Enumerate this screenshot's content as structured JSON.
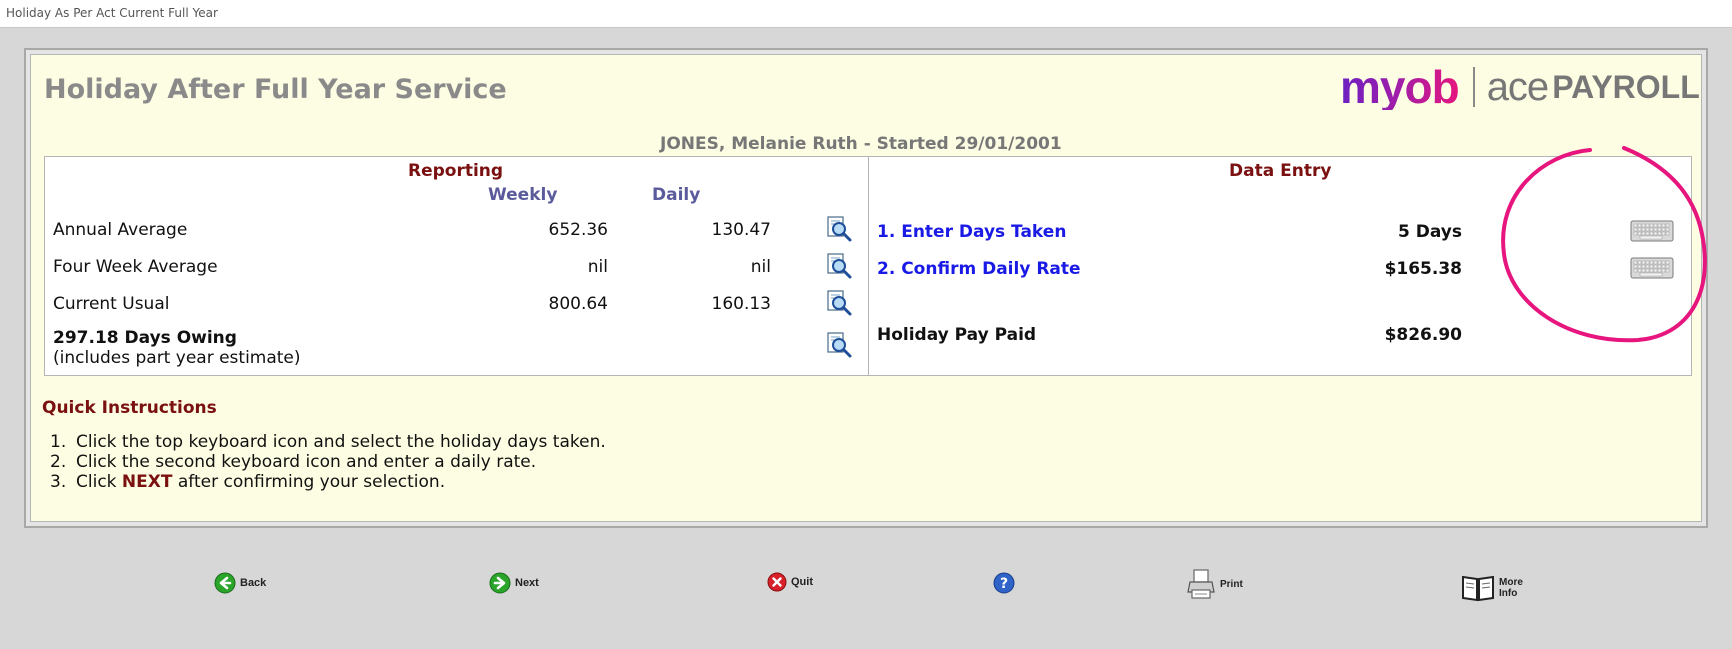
{
  "window": {
    "title": "Holiday As Per Act Current Full Year"
  },
  "header": {
    "title": "Holiday After Full Year Service",
    "logo": {
      "brand": "myob",
      "product_a": "ace",
      "product_b": "PAYROLL"
    },
    "employee": "JONES, Melanie Ruth - Started 29/01/2001"
  },
  "reporting": {
    "title": "Reporting",
    "col_weekly": "Weekly",
    "col_daily": "Daily",
    "rows": [
      {
        "label": "Annual Average",
        "weekly": "652.36",
        "daily": "130.47",
        "icon": "magnifier-icon"
      },
      {
        "label": "Four Week Average",
        "weekly": "nil",
        "daily": "nil",
        "icon": "magnifier-icon"
      },
      {
        "label": "Current Usual",
        "weekly": "800.64",
        "daily": "160.13",
        "icon": "magnifier-icon"
      }
    ],
    "owing": {
      "label": "297.18 Days Owing",
      "note": "(includes part year estimate)",
      "icon": "magnifier-icon"
    }
  },
  "data_entry": {
    "title": "Data Entry",
    "days_taken_label": "1. Enter Days Taken",
    "days_taken_value": "5 Days",
    "daily_rate_label": "2. Confirm Daily Rate",
    "daily_rate_value": "$165.38",
    "pay_paid_label": "Holiday Pay Paid",
    "pay_paid_value": "$826.90",
    "icon": "keyboard-icon"
  },
  "instructions": {
    "title": "Quick Instructions",
    "items": [
      {
        "num": "1.",
        "text": "Click the top keyboard icon and select the holiday days taken."
      },
      {
        "num": "2.",
        "text": "Click the second keyboard icon and enter a daily rate."
      },
      {
        "num": "3.",
        "pre": "Click ",
        "highlight": "NEXT",
        "post": " after confirming your selection."
      }
    ]
  },
  "toolbar": {
    "back": "Back",
    "next": "Next",
    "quit": "Quit",
    "print": "Print",
    "more_info_line1": "More",
    "more_info_line2": "Info"
  },
  "colors": {
    "panel_bg": "#fdfde3",
    "heading_maroon": "#7a1010",
    "link_blue": "#1a1ae6",
    "column_head": "#5b5b9c",
    "annotation_pink": "#e7157e"
  }
}
